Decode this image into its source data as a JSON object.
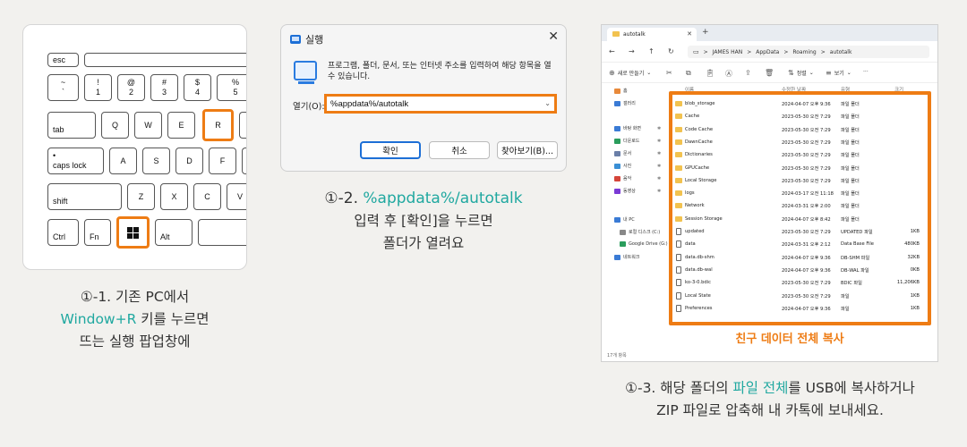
{
  "keyboard": {
    "keys": {
      "esc": "esc",
      "tilde_top": "~",
      "tilde_bottom": "`",
      "excl_top": "!",
      "excl_bottom": "1",
      "at_top": "@",
      "at_bottom": "2",
      "hash_top": "#",
      "hash_bottom": "3",
      "dollar_top": "$",
      "dollar_bottom": "4",
      "pct_top": "%",
      "pct_bottom": "5",
      "tab": "tab",
      "q": "Q",
      "w": "W",
      "e": "E",
      "r": "R",
      "capslock_dot": "•",
      "capslock": "caps lock",
      "a": "A",
      "s": "S",
      "d": "D",
      "f": "F",
      "shift": "shift",
      "z": "Z",
      "x": "X",
      "c": "C",
      "v": "V",
      "ctrl": "Ctrl",
      "fn": "Fn",
      "alt": "Alt"
    }
  },
  "run_dialog": {
    "title": "실행",
    "close_glyph": "✕",
    "description": "프로그램, 폴더, 문서, 또는 인터넷 주소를 입력하여 해당 항목을 열 수 있습니다.",
    "open_label": "열기(O):",
    "input_value": "%appdata%/autotalk",
    "confirm_label": "확인",
    "cancel_label": "취소",
    "browse_label": "찾아보기(B)..."
  },
  "explorer": {
    "tab_title": "autotalk",
    "tab_close": "✕",
    "new_tab": "+",
    "breadcrumb": [
      "JAMES HAN",
      "AppData",
      "Roaming",
      "autotalk"
    ],
    "breadcrumb_sep": ">",
    "cmd": {
      "new": "새로 만들기",
      "sort": "정렬",
      "view": "보기",
      "more": "···"
    },
    "columns": {
      "name": "이름",
      "modified": "수정한 날짜",
      "type": "유형",
      "size": "크기"
    },
    "sidebar": [
      {
        "label": "홈",
        "color": "#e8893a"
      },
      {
        "label": "갤러리",
        "color": "#3a7bd5"
      },
      {
        "label": "바탕 화면",
        "color": "#3a7bd5",
        "pinned": true
      },
      {
        "label": "다운로드",
        "color": "#2a9d5c",
        "pinned": true
      },
      {
        "label": "문서",
        "color": "#6a7fa8",
        "pinned": true
      },
      {
        "label": "사진",
        "color": "#3a8fd5",
        "pinned": true
      },
      {
        "label": "음악",
        "color": "#d5453a",
        "pinned": true
      },
      {
        "label": "동영상",
        "color": "#7a3ad5",
        "pinned": true
      },
      {
        "label": "내 PC",
        "color": "#3a7bd5"
      },
      {
        "label": "로컬 디스크 (C:)",
        "color": "#888888"
      },
      {
        "label": "Google Drive (G:)",
        "color": "#2a9d5c"
      },
      {
        "label": "네트워크",
        "color": "#3a7bd5"
      }
    ],
    "pin_glyph": "✱",
    "files": [
      {
        "name": "blob_storage",
        "modified": "2024-04-07 오후 9:36",
        "type": "파일 폴더",
        "size": "",
        "folder": true
      },
      {
        "name": "Cache",
        "modified": "2023-05-30 오전 7:29",
        "type": "파일 폴더",
        "size": "",
        "folder": true
      },
      {
        "name": "Code Cache",
        "modified": "2023-05-30 오전 7:29",
        "type": "파일 폴더",
        "size": "",
        "folder": true
      },
      {
        "name": "DawnCache",
        "modified": "2023-05-30 오전 7:29",
        "type": "파일 폴더",
        "size": "",
        "folder": true
      },
      {
        "name": "Dictionaries",
        "modified": "2023-05-30 오전 7:29",
        "type": "파일 폴더",
        "size": "",
        "folder": true
      },
      {
        "name": "GPUCache",
        "modified": "2023-05-30 오전 7:29",
        "type": "파일 폴더",
        "size": "",
        "folder": true
      },
      {
        "name": "Local Storage",
        "modified": "2023-05-30 오전 7:29",
        "type": "파일 폴더",
        "size": "",
        "folder": true
      },
      {
        "name": "logs",
        "modified": "2024-03-17 오전 11:18",
        "type": "파일 폴더",
        "size": "",
        "folder": true
      },
      {
        "name": "Network",
        "modified": "2024-03-31 오후 2:00",
        "type": "파일 폴더",
        "size": "",
        "folder": true
      },
      {
        "name": "Session Storage",
        "modified": "2024-04-07 오후 8:42",
        "type": "파일 폴더",
        "size": "",
        "folder": true
      },
      {
        "name": "updated",
        "modified": "2023-05-30 오전 7:29",
        "type": "UPDATED 파일",
        "size": "1KB",
        "folder": false
      },
      {
        "name": "data",
        "modified": "2024-03-31 오후 2:12",
        "type": "Data Base File",
        "size": "480KB",
        "folder": false
      },
      {
        "name": "data.db-shm",
        "modified": "2024-04-07 오후 9:36",
        "type": "DB-SHM 파일",
        "size": "32KB",
        "folder": false
      },
      {
        "name": "data.db-wal",
        "modified": "2024-04-07 오후 9:36",
        "type": "DB-WAL 파일",
        "size": "0KB",
        "folder": false
      },
      {
        "name": "ko-3-0.bdic",
        "modified": "2023-05-30 오전 7:29",
        "type": "BDIC 파일",
        "size": "11,206KB",
        "folder": false
      },
      {
        "name": "Local State",
        "modified": "2023-05-30 오전 7:29",
        "type": "파일",
        "size": "1KB",
        "folder": false
      },
      {
        "name": "Preferences",
        "modified": "2024-04-07 오후 9:36",
        "type": "파일",
        "size": "1KB",
        "folder": false
      }
    ],
    "copy_label": "친구 데이터 전체 복사",
    "status": "17개 항목"
  },
  "captions": {
    "step1_line1": "①-1. 기존 PC에서",
    "step1_line2_teal": "Window+R",
    "step1_line2_rest": " 키를 누르면",
    "step1_line3": "뜨는 실행 팝업창에",
    "step2_line1_prefix": "①-2. ",
    "step2_line1_teal": "%appdata%/autotalk",
    "step2_line2": "입력 후 [확인]을 누르면",
    "step2_line3": "폴더가 열려요",
    "step3_line1_a": "①-3. 해당 폴더의 ",
    "step3_line1_teal": "파일 전체",
    "step3_line1_b": "를 USB에 복사하거나",
    "step3_line2": "ZIP 파일로 압축해 내 카톡에 보내세요."
  },
  "colors": {
    "accent_orange": "#ee7c14",
    "accent_teal": "#20a8a0"
  }
}
